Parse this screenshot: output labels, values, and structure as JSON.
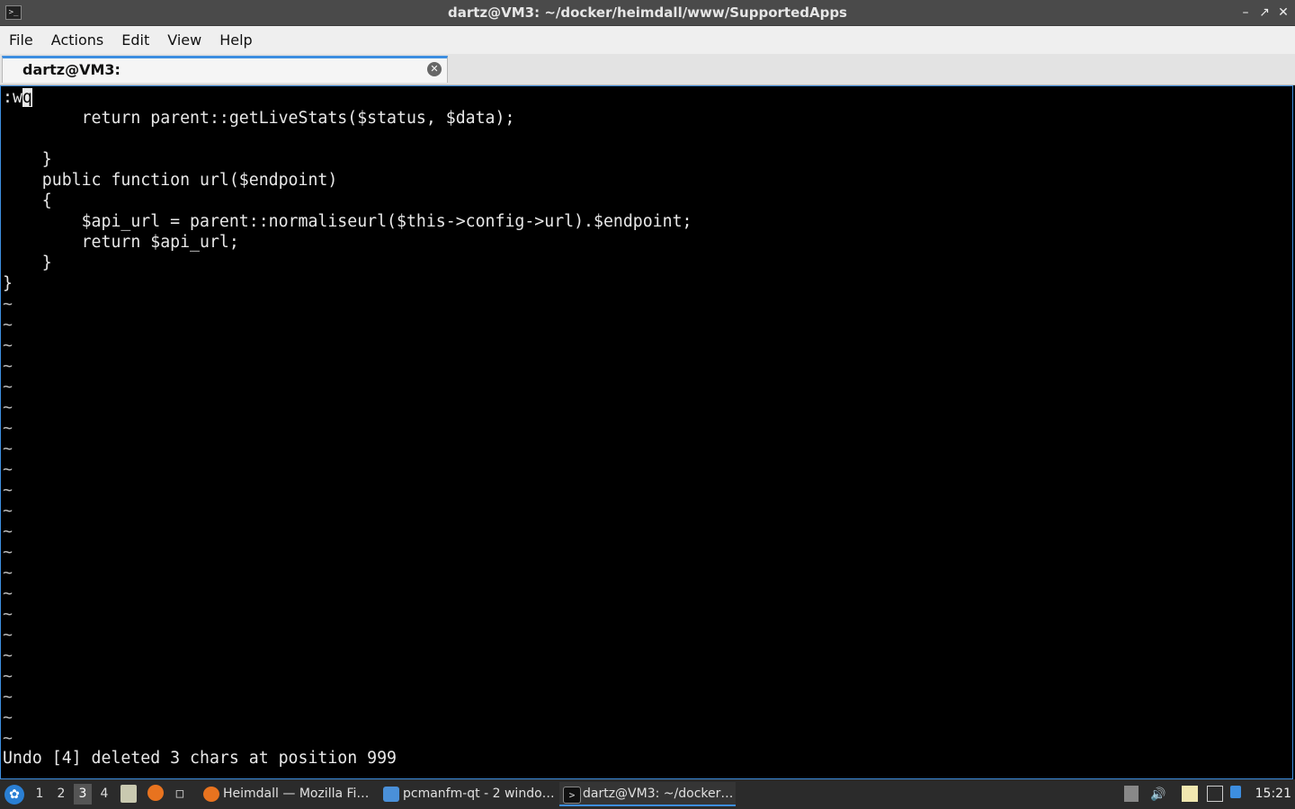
{
  "window": {
    "title": "dartz@VM3: ~/docker/heimdall/www/SupportedApps",
    "icon": "terminal-icon",
    "controls": [
      "minimize",
      "maximize",
      "close"
    ]
  },
  "menu": {
    "items": [
      "File",
      "Actions",
      "Edit",
      "View",
      "Help"
    ]
  },
  "tab": {
    "label": "dartz@VM3: ~/docker/heimdall/www/SupportedApps"
  },
  "terminal": {
    "command_prefix": ":w",
    "command_cursor": "q",
    "lines": [
      "        return parent::getLiveStats($status, $data);",
      "",
      "    }",
      "    public function url($endpoint)",
      "    {",
      "        $api_url = parent::normaliseurl($this->config->url).$endpoint;",
      "        return $api_url;",
      "    }",
      "}"
    ],
    "tilde_char": "~",
    "tilde_count": 22,
    "status_line": "Undo [4] deleted 3 chars at position 999"
  },
  "taskbar": {
    "desktops": [
      "1",
      "2",
      "3",
      "4"
    ],
    "active_desktop": "3",
    "tasks": [
      {
        "label": "Heimdall — Mozilla Fi…",
        "icon": "firefox-icon"
      },
      {
        "label": "pcmanfm-qt - 2 windo…",
        "icon": "folder-icon"
      },
      {
        "label": "dartz@VM3: ~/docker…",
        "icon": "terminal-icon"
      }
    ],
    "clock": "15:21"
  },
  "colors": {
    "accent": "#3d8ee0",
    "terminal_bg": "#000000",
    "terminal_fg": "#e8e8e8"
  }
}
